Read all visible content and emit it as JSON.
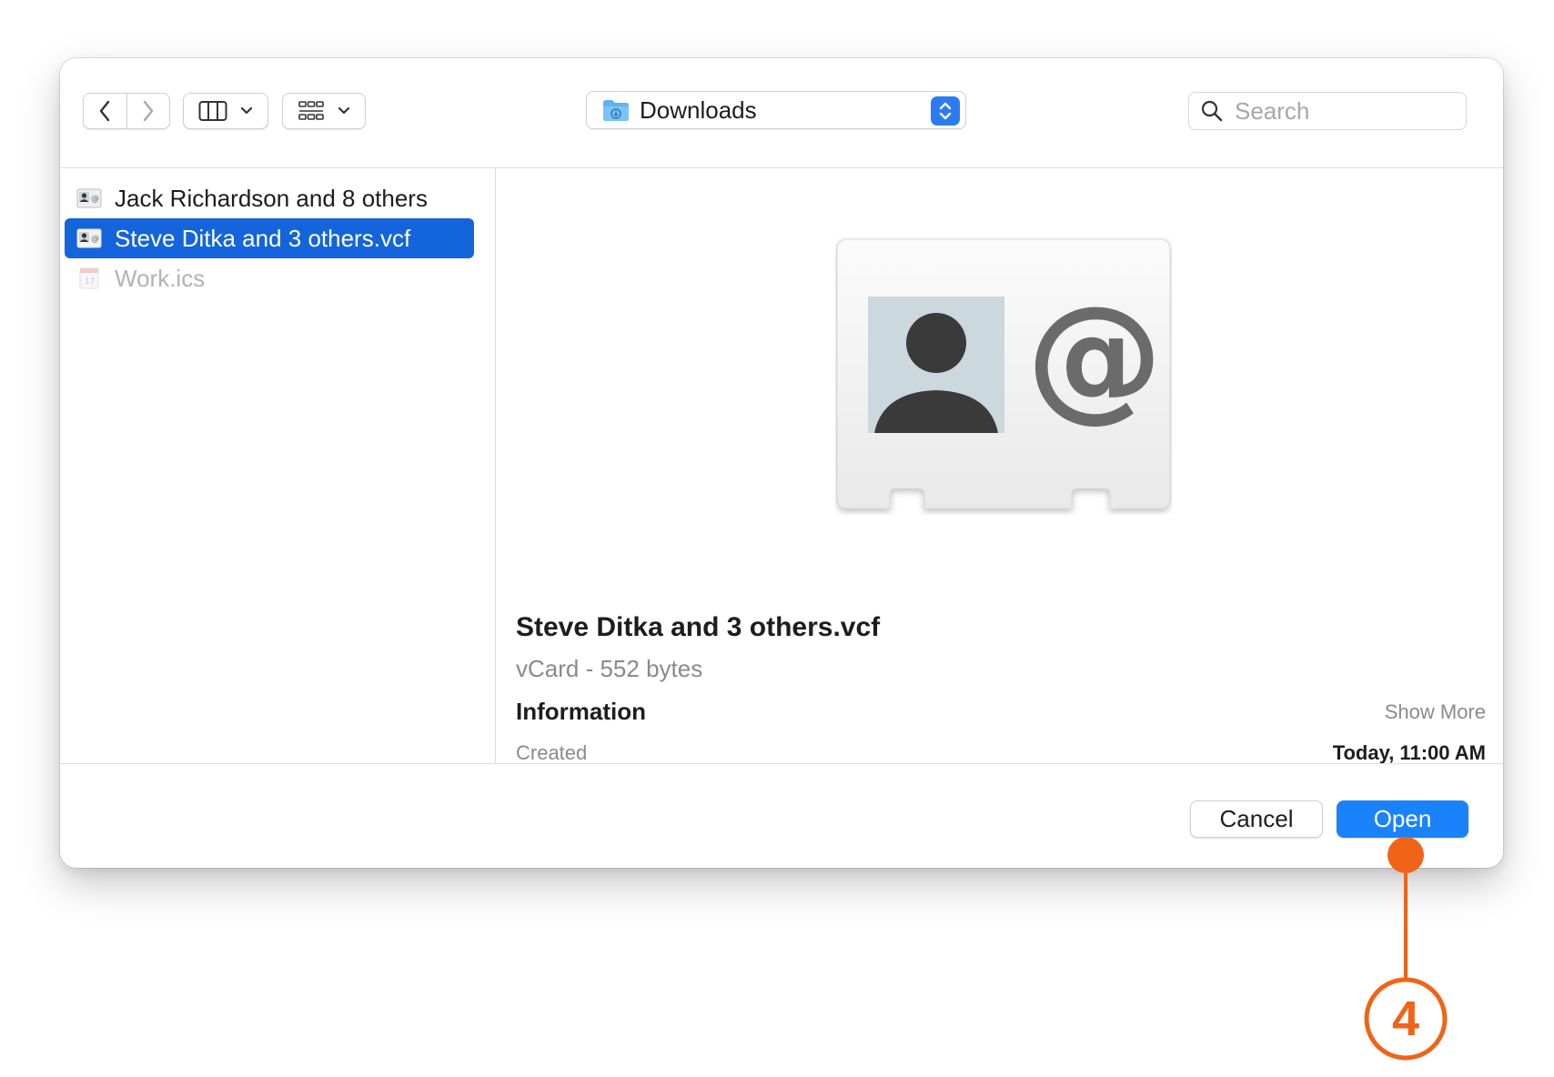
{
  "toolbar": {
    "back_icon": "chevron-left-icon",
    "forward_icon": "chevron-right-icon",
    "view_icon": "column-view-icon",
    "group_icon": "icon-grid-icon",
    "location": "Downloads",
    "search_placeholder": "Search"
  },
  "sidebar": {
    "files": [
      {
        "name": "Jack Richardson and 8 others",
        "icon": "vcard-icon",
        "state": "normal"
      },
      {
        "name": "Steve Ditka and 3 others.vcf",
        "icon": "vcard-icon",
        "state": "selected"
      },
      {
        "name": "Work.ics",
        "icon": "calendar-icon",
        "state": "disabled"
      }
    ]
  },
  "preview": {
    "filename": "Steve Ditka and 3 others.vcf",
    "kind_size": "vCard - 552 bytes",
    "info_heading": "Information",
    "show_more": "Show More",
    "created_label": "Created",
    "created_value": "Today, 11:00 AM"
  },
  "footer": {
    "cancel_label": "Cancel",
    "open_label": "Open"
  },
  "callout": {
    "number": "4",
    "color": "#f06418"
  },
  "colors": {
    "selection": "#1464db",
    "accent": "#1a82fb"
  }
}
